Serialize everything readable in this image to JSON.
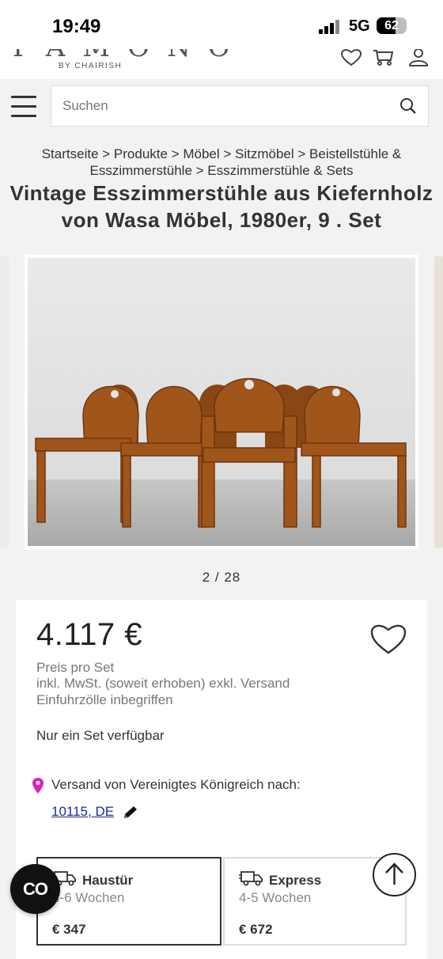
{
  "status_bar": {
    "time": "19:49",
    "network": "5G",
    "battery": "62",
    "battery_level": 0.62
  },
  "header": {
    "logo": "PAMONO",
    "logo_sub": "BY CHAIRISH",
    "icons": [
      "heart-icon",
      "cart-icon",
      "user-icon"
    ]
  },
  "search": {
    "placeholder": "Suchen"
  },
  "breadcrumb": [
    "Startseite",
    "Produkte",
    "Möbel",
    "Sitzmöbel",
    "Beistellstühle & Esszimmerstühle",
    "Esszimmerstühle & Sets"
  ],
  "product": {
    "title": "Vintage Esszimmerstühle aus Kiefernholz von Wasa Möbel, 1980er, 9 . Set",
    "image_counter": "2 / 28",
    "price": "4.117 €",
    "price_notes": [
      "Preis pro Set",
      "inkl. MwSt. (soweit erhoben) exkl. Versand",
      "Einfuhrzölle inbegriffen"
    ],
    "availability": "Nur ein Set verfügbar"
  },
  "shipping": {
    "from_text": "Versand von Vereinigtes Königreich nach:",
    "destination": "10115, DE",
    "options": [
      {
        "name": "Haustür",
        "time": "4-6 Wochen",
        "price": "€ 347",
        "selected": true
      },
      {
        "name": "Express",
        "time": "4-5 Wochen",
        "price": "€ 672",
        "selected": false
      }
    ]
  },
  "floating": {
    "chat_label": "CO"
  },
  "colors": {
    "accent_pin": "#e020b8",
    "link": "#1a2a9c",
    "wood": "#a0561b"
  }
}
